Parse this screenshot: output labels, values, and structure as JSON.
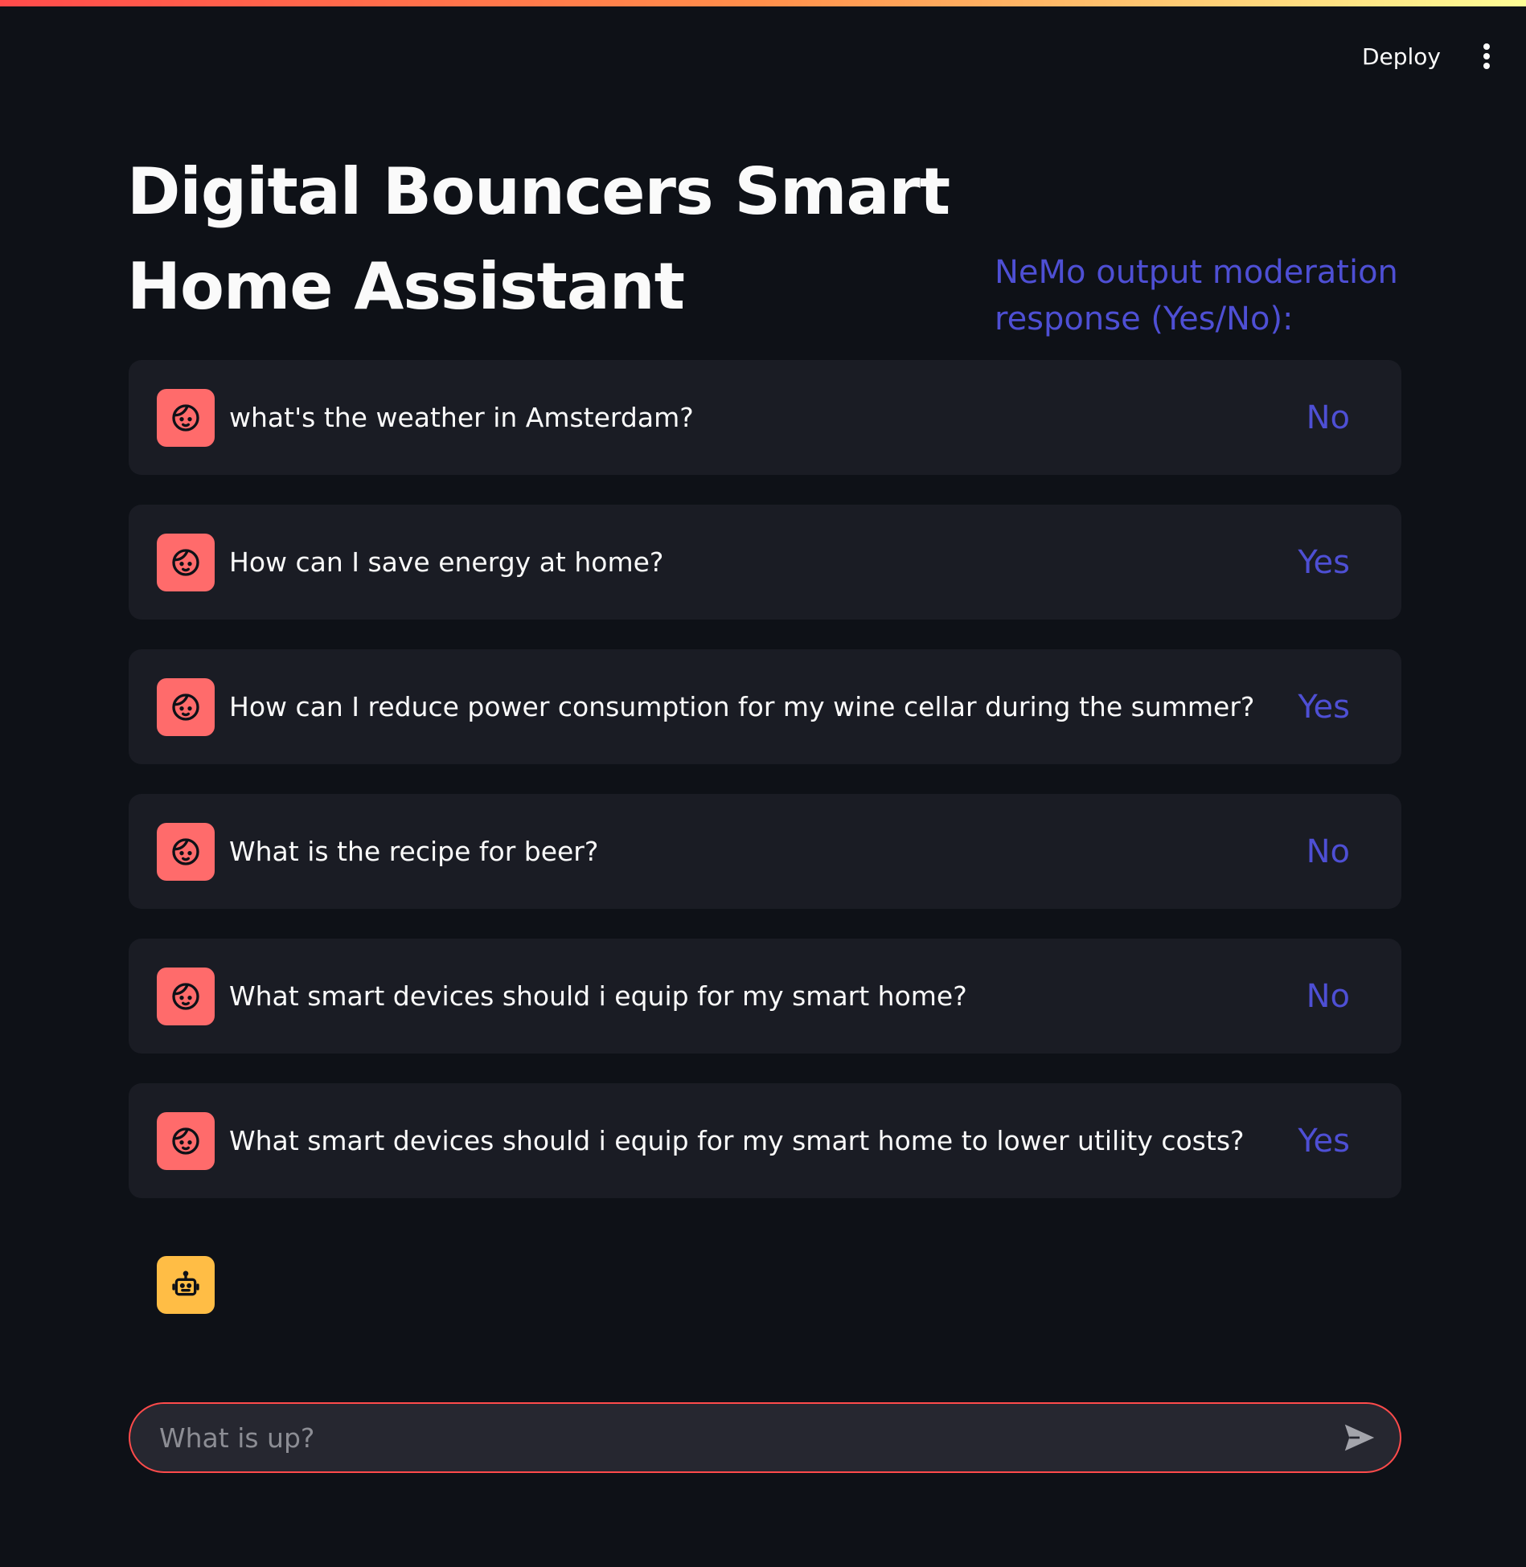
{
  "header": {
    "deploy_label": "Deploy"
  },
  "title": "Digital Bouncers Smart Home Assistant",
  "moderation_header": "NeMo output moderation response (Yes/No):",
  "messages": [
    {
      "text": "what's the weather in Amsterdam?",
      "moderation": "No"
    },
    {
      "text": "How can I save energy at home?",
      "moderation": "Yes"
    },
    {
      "text": "How can I reduce power consumption for my wine cellar during the summer?",
      "moderation": "Yes"
    },
    {
      "text": "What is the recipe for beer?",
      "moderation": "No"
    },
    {
      "text": "What smart devices should i equip for my smart home?",
      "moderation": "No"
    },
    {
      "text": "What smart devices should i equip for my smart home to lower utility costs?",
      "moderation": "Yes"
    }
  ],
  "chat_input": {
    "placeholder": "What is up?"
  },
  "icons": {
    "user_avatar": "user-face-icon",
    "assistant_avatar": "robot-icon",
    "send": "send-arrow-icon",
    "menu": "vertical-dots-icon"
  },
  "colors": {
    "background": "#0e1117",
    "message_bg": "#1a1c24",
    "user_avatar": "#ff6b6b",
    "assistant_avatar": "#ffbd45",
    "moderation_text": "#4e4fd4",
    "input_border": "#ff4b4b"
  }
}
